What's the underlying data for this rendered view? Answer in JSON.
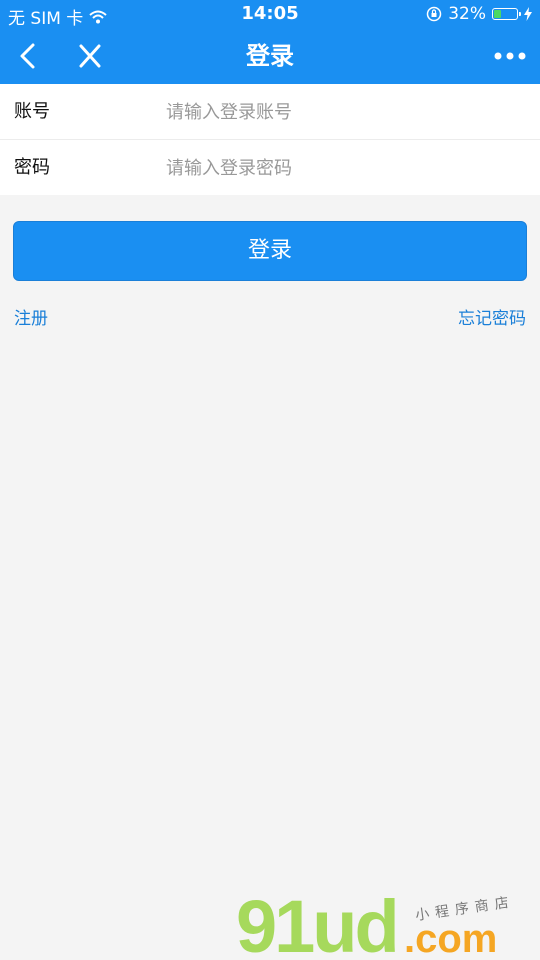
{
  "status_bar": {
    "carrier": "无 SIM 卡",
    "time": "14:05",
    "battery_percent_label": "32%",
    "battery_level": 0.32,
    "icons": [
      "wifi-icon",
      "orientation-lock-icon",
      "battery-icon",
      "charging-bolt-icon"
    ]
  },
  "nav": {
    "title": "登录",
    "icons": [
      "back-chevron-icon",
      "close-icon",
      "more-dots-icon"
    ]
  },
  "form": {
    "account": {
      "label": "账号",
      "placeholder": "请输入登录账号",
      "value": ""
    },
    "password": {
      "label": "密码",
      "placeholder": "请输入登录密码",
      "value": ""
    }
  },
  "actions": {
    "login_label": "登录",
    "register_label": "注册",
    "forgot_label": "忘记密码"
  },
  "watermark": {
    "brand": "91ud",
    "domain": ".com",
    "tagline": "小程序商店"
  },
  "colors": {
    "accent": "#1a8ff2",
    "link": "#1a7fd8",
    "background": "#f4f4f4",
    "watermark_green": "#a6d95c",
    "watermark_orange": "#f5a623"
  }
}
